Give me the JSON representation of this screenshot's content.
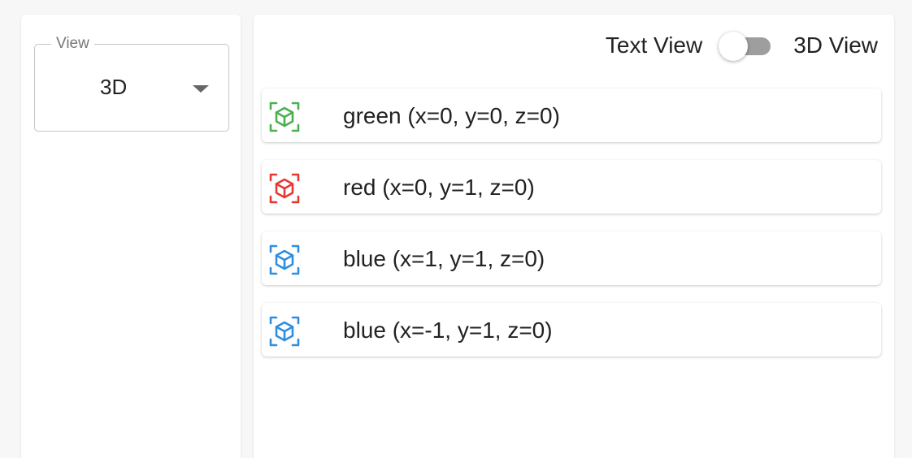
{
  "view_select": {
    "label": "View",
    "value": "3D"
  },
  "view_toggle": {
    "left_label": "Text View",
    "right_label": "3D View",
    "checked": false
  },
  "items": [
    {
      "label": "green (x=0, y=0, z=0)",
      "color": "#4caf50",
      "icon": "cube-icon"
    },
    {
      "label": "red (x=0, y=1, z=0)",
      "color": "#e53935",
      "icon": "cube-icon"
    },
    {
      "label": "blue (x=1, y=1, z=0)",
      "color": "#2f8ee0",
      "icon": "cube-icon"
    },
    {
      "label": "blue (x=-1, y=1, z=0)",
      "color": "#2f8ee0",
      "icon": "cube-icon"
    }
  ]
}
